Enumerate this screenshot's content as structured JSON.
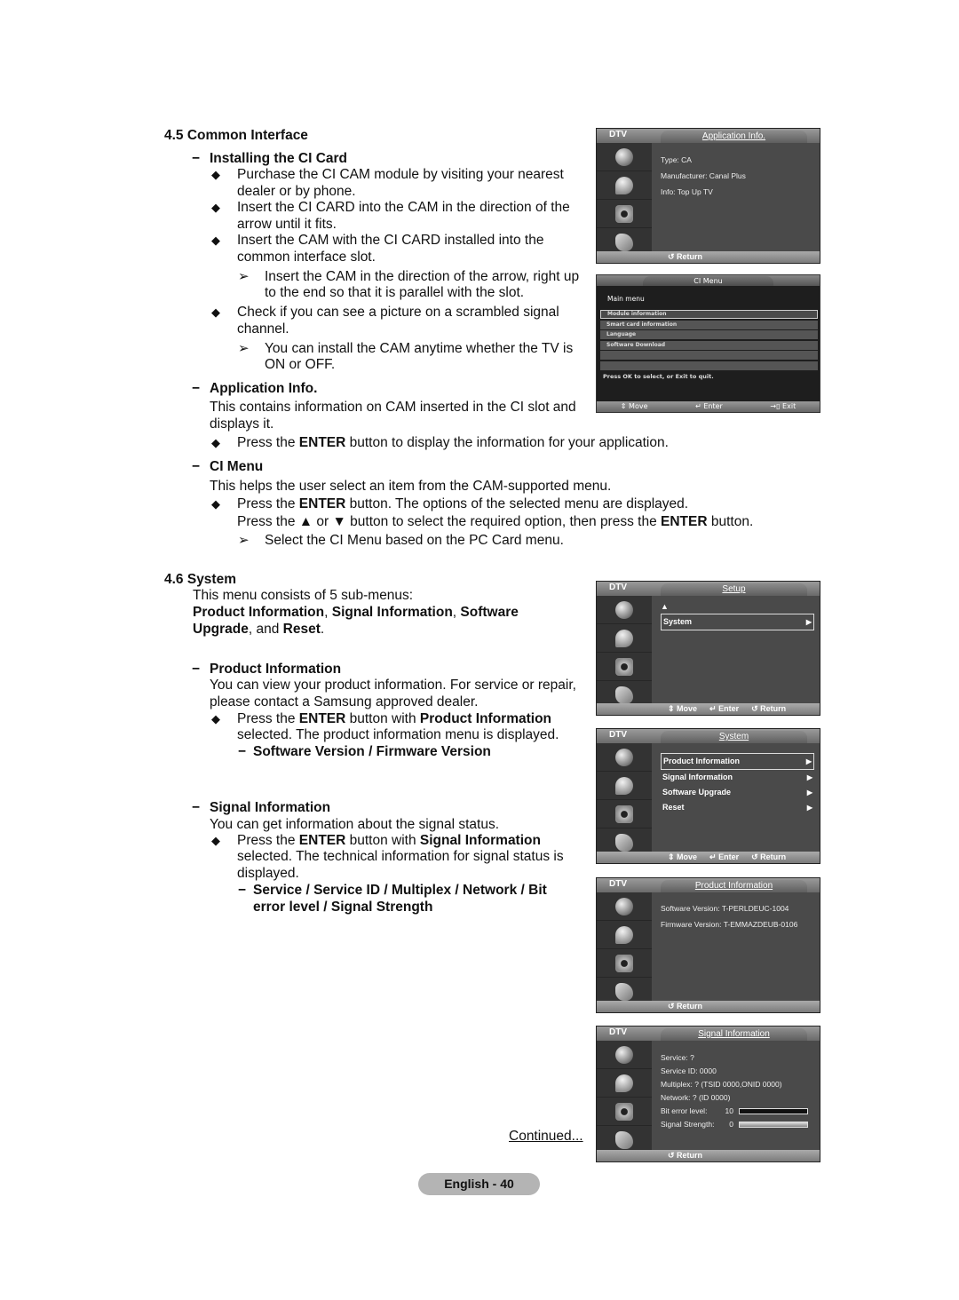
{
  "section_45": {
    "heading": "4.5  Common Interface",
    "installing": {
      "heading": "Installing the CI Card",
      "bullets": [
        [
          "Purchase the CI CAM module by visiting your nearest",
          "dealer or by phone."
        ],
        [
          "Insert the CI CARD into the CAM in the direction of the",
          "arrow until it fits."
        ],
        [
          "Insert the CAM with the CI CARD installed into the",
          "common interface slot."
        ]
      ],
      "note1": [
        "Insert the CAM in the direction of the arrow, right up",
        "to the end so that it is parallel with the slot."
      ],
      "bullet4": [
        "Check if you can see a picture on a scrambled signal",
        "channel."
      ],
      "note2": [
        "You can install the CAM anytime whether the TV is",
        "ON or OFF."
      ]
    },
    "application_info": {
      "heading": "Application Info.",
      "desc": [
        "This contains information on CAM inserted in the CI slot and",
        "displays it."
      ],
      "bullet": {
        "pre": "Press the ",
        "bold": "ENTER",
        "post": " button to display the information for your application."
      }
    },
    "ci_menu": {
      "heading": "CI Menu",
      "desc": "This helps the user select an item from the CAM-supported menu.",
      "bullet_l1": {
        "pre": "Press the ",
        "bold": "ENTER",
        "post": " button. The options of the selected menu are displayed."
      },
      "bullet_l2": {
        "pre": "Press the ▲ or ▼ button to select the required option, then press the ",
        "bold": "ENTER",
        "post": " button."
      },
      "note": "Select the CI Menu based on the PC Card menu."
    }
  },
  "section_46": {
    "heading": "4.6  System",
    "intro": "This menu consists of 5 sub-menus:",
    "submenus_l1": {
      "a": "Product Information",
      "sep1": ", ",
      "b": "Signal Information",
      "sep2": ", ",
      "c": "Software"
    },
    "submenus_l2": {
      "a": "Upgrade",
      "sep": ", and ",
      "b": "Reset",
      "end": "."
    },
    "product_info": {
      "heading": "Product Information",
      "desc": [
        "You can view your product information. For service or repair,",
        "please contact a Samsung approved dealer."
      ],
      "bullet_l1": {
        "pre": "Press the ",
        "b1": "ENTER",
        "mid": " button with ",
        "b2": "Product Information"
      },
      "bullet_l2": "selected. The product information menu is displayed.",
      "sub": "Software Version / Firmware Version"
    },
    "signal_info": {
      "heading": "Signal Information",
      "desc": "You can get information about the signal status.",
      "bullet_l1": {
        "pre": "Press the ",
        "b1": "ENTER",
        "mid": " button with ",
        "b2": "Signal Information"
      },
      "bullet_l2": "selected. The technical information for signal status is",
      "bullet_l3": "displayed.",
      "sub": [
        "Service / Service ID / Multiplex / Network / Bit",
        "error level / Signal Strength"
      ]
    }
  },
  "symbols": {
    "dash": "−",
    "diamond": "◆",
    "arrow": "➢"
  },
  "screens": {
    "application_info": {
      "mode": "DTV",
      "title": "Application Info.",
      "rows": [
        "Type: CA",
        "Manufacturer: Canal Plus",
        "Info: Top Up TV"
      ],
      "footer": "↺ Return"
    },
    "ci_menu": {
      "title": "CI Menu",
      "subtitle": "Main menu",
      "items": [
        "Module information",
        "Smart card information",
        "Language",
        "Software Download",
        "",
        ""
      ],
      "hint": "Press OK to select, or Exit to quit.",
      "footer": [
        "⇕ Move",
        "↵ Enter",
        "→▯ Exit"
      ]
    },
    "setup": {
      "mode": "DTV",
      "title": "Setup",
      "up": "▲",
      "items": [
        {
          "label": "System",
          "arrow": "▶"
        }
      ],
      "footer": [
        "⇕ Move",
        "↵ Enter",
        "↺ Return"
      ]
    },
    "system": {
      "mode": "DTV",
      "title": "System",
      "items": [
        {
          "label": "Product Information",
          "arrow": "▶"
        },
        {
          "label": "Signal Information",
          "arrow": "▶"
        },
        {
          "label": "Software Upgrade",
          "arrow": "▶"
        },
        {
          "label": "Reset",
          "arrow": "▶"
        }
      ],
      "footer": [
        "⇕ Move",
        "↵ Enter",
        "↺ Return"
      ]
    },
    "product_info": {
      "mode": "DTV",
      "title": "Product Information",
      "rows": [
        "Software Version: T-PERLDEUC-1004",
        "Firmware Version: T-EMMAZDEUB-0106"
      ],
      "footer": "↺ Return"
    },
    "signal_info": {
      "mode": "DTV",
      "title": "Signal Information",
      "rows": [
        "Service: ?",
        "Service ID: 0000",
        "Multiplex: ? (TSID 0000,ONID 0000)",
        "Network: ? (ID 0000)"
      ],
      "bit_error": {
        "label": "Bit error level:",
        "value": "10",
        "fill": 1.0
      },
      "signal_strength": {
        "label": "Signal Strength:",
        "value": "0",
        "fill": 0.0
      },
      "footer": "↺ Return"
    }
  },
  "footer": {
    "continued": "Continued...",
    "page": "English - 40"
  }
}
